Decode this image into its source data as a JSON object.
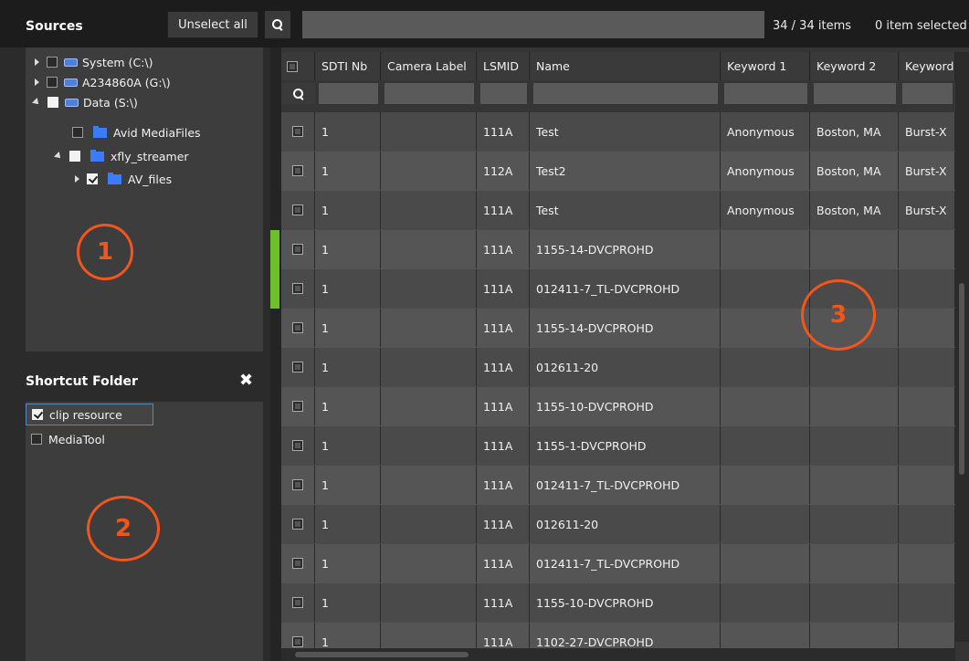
{
  "toolbar": {
    "sources_title": "Sources",
    "unselect_all_label": "Unselect all",
    "items_count": "34 / 34 items",
    "items_selected": "0 item selected"
  },
  "tree": [
    {
      "label": "System (C:\\)"
    },
    {
      "label": "A234860A (G:\\)"
    },
    {
      "label": "Data (S:\\)"
    },
    {
      "label": "Avid MediaFiles"
    },
    {
      "label": "xfly_streamer"
    },
    {
      "label": "AV_files"
    }
  ],
  "badges": {
    "one": "1",
    "two": "2",
    "three": "3"
  },
  "shortcut": {
    "title": "Shortcut Folder",
    "items": [
      {
        "label": "clip resource",
        "checked": true
      },
      {
        "label": "MediaTool",
        "checked": false
      }
    ]
  },
  "table": {
    "columns": [
      "SDTI Nb",
      "Camera Label",
      "LSMID",
      "Name",
      "Keyword 1",
      "Keyword 2",
      "Keyword"
    ],
    "rows": [
      {
        "sdti": "1",
        "camera": "",
        "lsmid": "111A",
        "name": "Test",
        "kw1": "Anonymous",
        "kw2": "Boston, MA",
        "kw3": "Burst-X"
      },
      {
        "sdti": "1",
        "camera": "",
        "lsmid": "112A",
        "name": "Test2",
        "kw1": "Anonymous",
        "kw2": "Boston, MA",
        "kw3": "Burst-X"
      },
      {
        "sdti": "1",
        "camera": "",
        "lsmid": "111A",
        "name": "Test",
        "kw1": "Anonymous",
        "kw2": "Boston, MA",
        "kw3": "Burst-X"
      },
      {
        "sdti": "1",
        "camera": "",
        "lsmid": "111A",
        "name": "1155-14-DVCPROHD",
        "kw1": "",
        "kw2": "",
        "kw3": ""
      },
      {
        "sdti": "1",
        "camera": "",
        "lsmid": "111A",
        "name": "012411-7_TL-DVCPROHD",
        "kw1": "",
        "kw2": "",
        "kw3": ""
      },
      {
        "sdti": "1",
        "camera": "",
        "lsmid": "111A",
        "name": "1155-14-DVCPROHD",
        "kw1": "",
        "kw2": "",
        "kw3": ""
      },
      {
        "sdti": "1",
        "camera": "",
        "lsmid": "111A",
        "name": "012611-20",
        "kw1": "",
        "kw2": "",
        "kw3": ""
      },
      {
        "sdti": "1",
        "camera": "",
        "lsmid": "111A",
        "name": "1155-10-DVCPROHD",
        "kw1": "",
        "kw2": "",
        "kw3": ""
      },
      {
        "sdti": "1",
        "camera": "",
        "lsmid": "111A",
        "name": "1155-1-DVCPROHD",
        "kw1": "",
        "kw2": "",
        "kw3": ""
      },
      {
        "sdti": "1",
        "camera": "",
        "lsmid": "111A",
        "name": "012411-7_TL-DVCPROHD",
        "kw1": "",
        "kw2": "",
        "kw3": ""
      },
      {
        "sdti": "1",
        "camera": "",
        "lsmid": "111A",
        "name": "012611-20",
        "kw1": "",
        "kw2": "",
        "kw3": ""
      },
      {
        "sdti": "1",
        "camera": "",
        "lsmid": "111A",
        "name": "012411-7_TL-DVCPROHD",
        "kw1": "",
        "kw2": "",
        "kw3": ""
      },
      {
        "sdti": "1",
        "camera": "",
        "lsmid": "111A",
        "name": "1155-10-DVCPROHD",
        "kw1": "",
        "kw2": "",
        "kw3": ""
      },
      {
        "sdti": "1",
        "camera": "",
        "lsmid": "111A",
        "name": "1102-27-DVCPROHD",
        "kw1": "",
        "kw2": "",
        "kw3": ""
      }
    ]
  },
  "colors": {
    "accent": "#f2561d",
    "marker": "#6fbf2c",
    "panel": "#3d3d3d",
    "folder": "#3c7bff"
  },
  "icons": {
    "search": "search-icon",
    "close": "close-icon",
    "folder": "folder-icon",
    "drive": "drive-icon"
  }
}
